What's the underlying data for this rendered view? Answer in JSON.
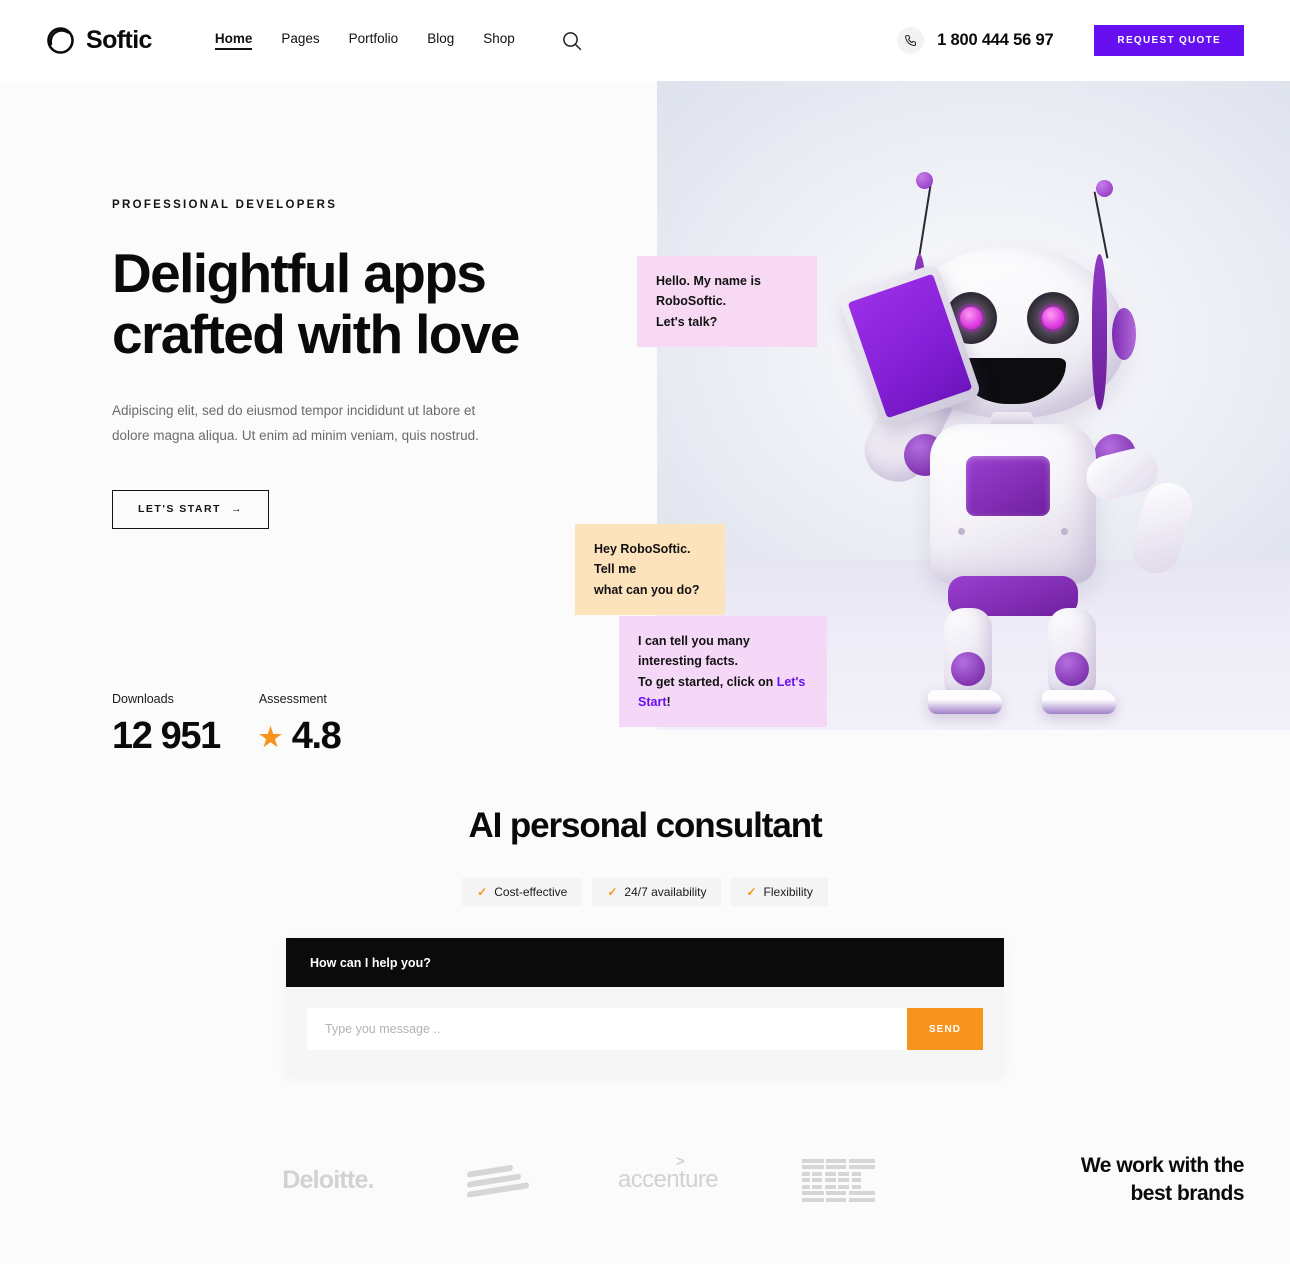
{
  "header": {
    "logo_text": "Softic",
    "nav": [
      {
        "label": "Home",
        "active": true
      },
      {
        "label": "Pages",
        "active": false
      },
      {
        "label": "Portfolio",
        "active": false
      },
      {
        "label": "Blog",
        "active": false
      },
      {
        "label": "Shop",
        "active": false
      }
    ],
    "search_icon": "search-icon",
    "phone_icon": "phone-icon",
    "phone": "1 800 444 56 97",
    "quote_button": "REQUEST QUOTE",
    "accent_color": "#6610f2"
  },
  "hero": {
    "eyebrow": "PROFESSIONAL DEVELOPERS",
    "title_line1": "Delightful apps",
    "title_line2": "crafted with love",
    "paragraph": "Adipiscing elit, sed do eiusmod tempor incididunt ut labore et dolore magna aliqua. Ut enim ad minim veniam, quis nostrud.",
    "cta_label": "LET'S START",
    "cta_arrow": "→",
    "stats": [
      {
        "label": "Downloads",
        "value": "12 951",
        "star": false
      },
      {
        "label": "Assessment",
        "value": "4.8",
        "star": true
      }
    ],
    "star_color": "#f7941d",
    "bubbles": [
      {
        "line1": "Hello. My name is RoboSoftic.",
        "line2": "Let's talk?",
        "color": "#f7d9f4"
      },
      {
        "line1": "Hey RoboSoftic. Tell me",
        "line2": "what can you do?",
        "color": "#fde3bc"
      },
      {
        "line1": "I can tell you many interesting facts.",
        "line2_pre": "To get started, click on ",
        "link": "Let's Start",
        "line2_post": "!",
        "color": "#f5d7f7"
      }
    ]
  },
  "ai_section": {
    "title": "AI personal consultant",
    "pills": [
      {
        "label": "Cost-effective",
        "check": "✓"
      },
      {
        "label": "24/7 availability",
        "check": "✓"
      },
      {
        "label": "Flexibility",
        "check": "✓"
      }
    ],
    "chat_header": "How can I help you?",
    "input_placeholder": "Type you message ..",
    "input_value": "",
    "send_label": "SEND",
    "send_color": "#f7941d"
  },
  "brands": {
    "logos": [
      "Deloitte.",
      "bank-of-america-logo",
      "accenture",
      "IBM"
    ],
    "deloitte": "Deloitte.",
    "accenture": "accenture",
    "ibm": "IBM",
    "title_line1": "We work with the",
    "title_line2": "best brands"
  }
}
